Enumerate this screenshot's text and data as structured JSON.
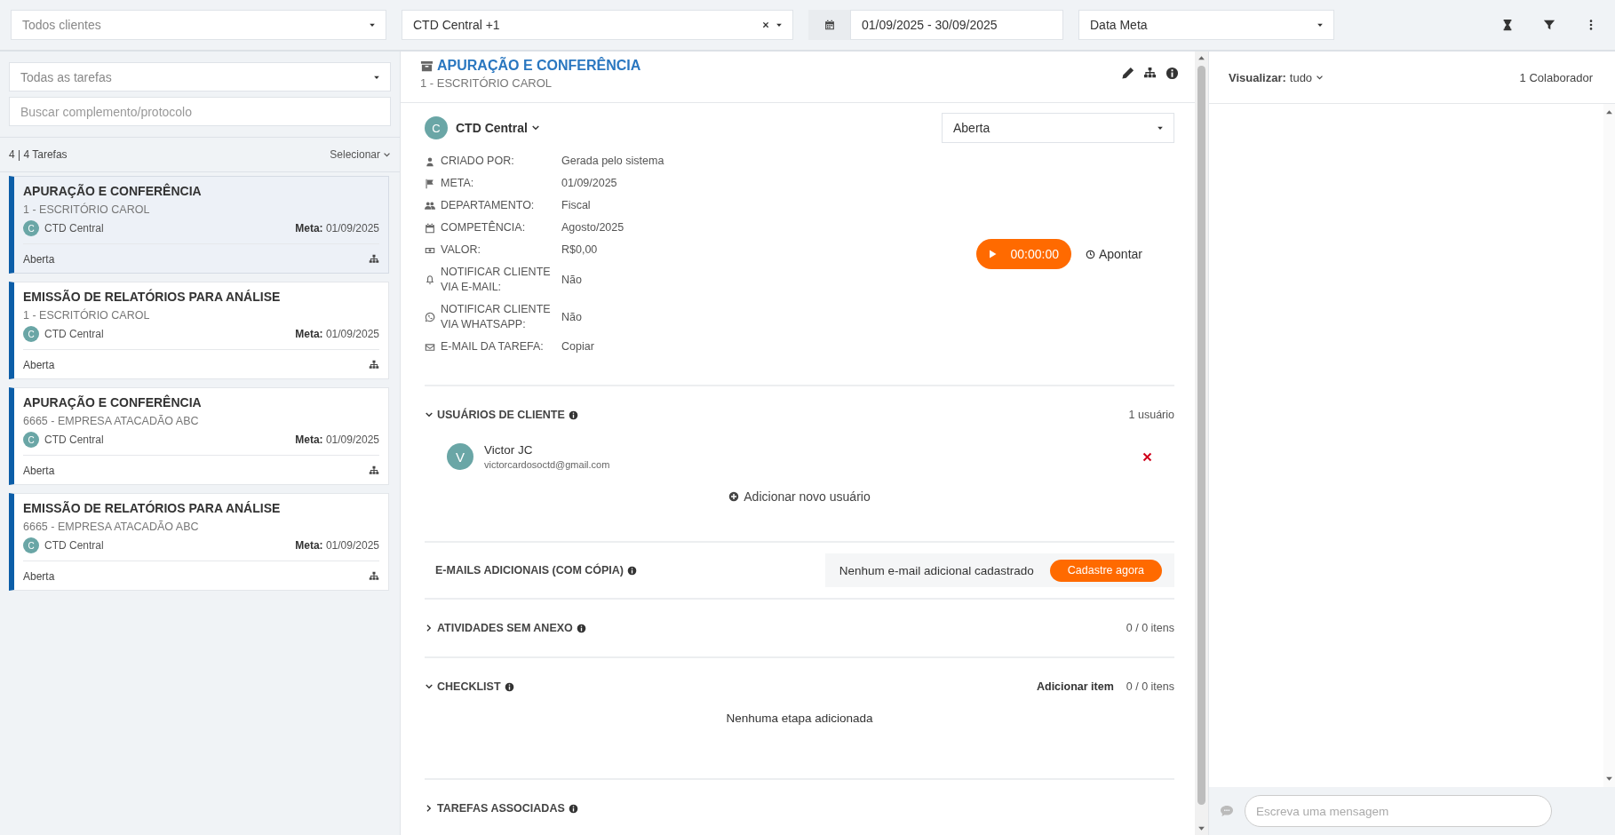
{
  "filters": {
    "client": {
      "placeholder": "Todos clientes"
    },
    "unit": {
      "value": "CTD Central +1"
    },
    "date_range": {
      "value": "01/09/2025 - 30/09/2025"
    },
    "date_type": {
      "value": "Data Meta"
    }
  },
  "task_list": {
    "type_filter": {
      "placeholder": "Todas as tarefas"
    },
    "search": {
      "placeholder": "Buscar complemento/protocolo"
    },
    "count": "4 | 4 Tarefas",
    "select": "Selecionar",
    "tasks": [
      {
        "title": "APURAÇÃO E CONFERÊNCIA",
        "client": "1 - ESCRITÓRIO CAROL",
        "unit_initial": "C",
        "unit": "CTD Central",
        "meta_label": "Meta:",
        "meta_date": "01/09/2025",
        "status": "Aberta",
        "selected": true
      },
      {
        "title": "EMISSÃO DE RELATÓRIOS PARA ANÁLISE",
        "client": "1 - ESCRITÓRIO CAROL",
        "unit_initial": "C",
        "unit": "CTD Central",
        "meta_label": "Meta:",
        "meta_date": "01/09/2025",
        "status": "Aberta",
        "selected": false
      },
      {
        "title": "APURAÇÃO E CONFERÊNCIA",
        "client": "6665 - EMPRESA ATACADÃO ABC",
        "unit_initial": "C",
        "unit": "CTD Central",
        "meta_label": "Meta:",
        "meta_date": "01/09/2025",
        "status": "Aberta",
        "selected": false
      },
      {
        "title": "EMISSÃO DE RELATÓRIOS PARA ANÁLISE",
        "client": "6665 - EMPRESA ATACADÃO ABC",
        "unit_initial": "C",
        "unit": "CTD Central",
        "meta_label": "Meta:",
        "meta_date": "01/09/2025",
        "status": "Aberta",
        "selected": false
      }
    ]
  },
  "detail": {
    "title": "APURAÇÃO E CONFERÊNCIA",
    "client": "1 - ESCRITÓRIO CAROL",
    "unit_initial": "C",
    "unit": "CTD Central",
    "status": "Aberta",
    "fields": [
      {
        "kind": "creator",
        "label": "CRIADO POR:",
        "value": "Gerada pelo sistema"
      },
      {
        "kind": "deadline",
        "label": "META:",
        "value": "01/09/2025"
      },
      {
        "kind": "department",
        "label": "DEPARTAMENTO:",
        "value": "Fiscal"
      },
      {
        "kind": "period",
        "label": "COMPETÊNCIA:",
        "value": "Agosto/2025"
      },
      {
        "kind": "amount",
        "label": "VALOR:",
        "value": "R$0,00"
      },
      {
        "kind": "notify_email",
        "label": "NOTIFICAR CLIENTE VIA E-MAIL:",
        "value": "Não"
      },
      {
        "kind": "notify_whatsapp",
        "label": "NOTIFICAR CLIENTE VIA WHATSAPP:",
        "value": "Não"
      },
      {
        "kind": "task_email",
        "label": "E-MAIL DA TAREFA:",
        "value": "Copiar"
      }
    ],
    "timer": "00:00:00",
    "log_time": "Apontar",
    "client_users": {
      "title": "USUÁRIOS DE CLIENTE",
      "expanded": true,
      "count": "1 usuário",
      "users": [
        {
          "initial": "V",
          "name": "Victor JC",
          "email": "victorcardosoctd@gmail.com"
        }
      ],
      "add": "Adicionar novo usuário"
    },
    "extra_emails": {
      "title": "E-MAILS ADICIONAIS (COM CÓPIA)",
      "empty": "Nenhum e-mail adicional cadastrado",
      "button": "Cadastre agora"
    },
    "activities": {
      "title": "ATIVIDADES SEM ANEXO",
      "expanded": false,
      "count": "0 / 0 itens"
    },
    "checklist": {
      "title": "CHECKLIST",
      "expanded": true,
      "add": "Adicionar item",
      "count": "0 / 0 itens",
      "empty": "Nenhuma etapa adicionada"
    },
    "associated": {
      "title": "TAREFAS ASSOCIADAS",
      "expanded": false
    }
  },
  "chat": {
    "view_label": "Visualizar:",
    "view_value": "tudo",
    "collaborators": "1 Colaborador",
    "message": {
      "placeholder": "Escreva uma mensagem"
    }
  }
}
